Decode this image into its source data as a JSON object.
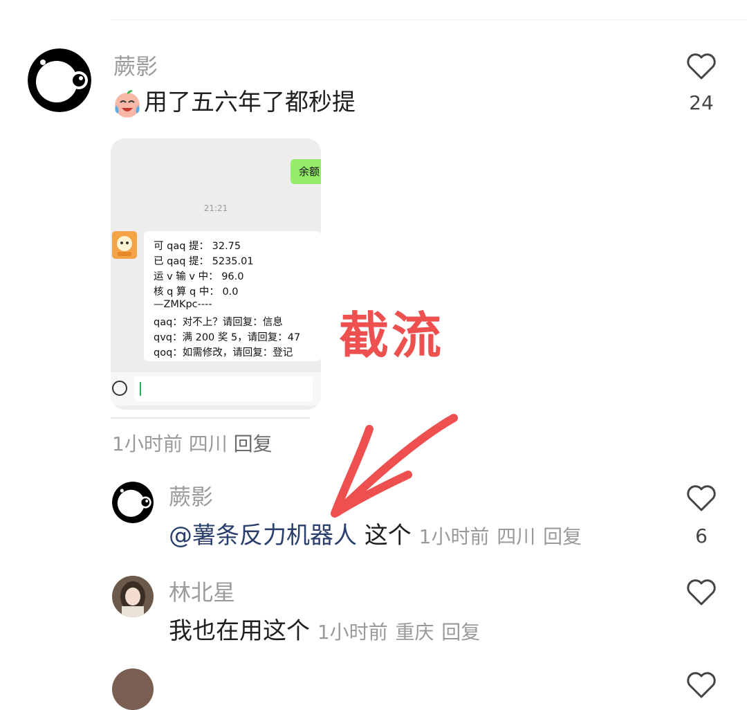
{
  "comments": [
    {
      "user": "蕨影",
      "text": "用了五六年了都秒提",
      "likes": "24",
      "time": "1小时前",
      "location": "四川",
      "reply_label": "回复",
      "attachment": {
        "balance_label": "余额",
        "time": "21:21",
        "bot_lines": [
          "可 qaq 提： 32.75",
          "已 qaq 提： 5235.01",
          "运 v 输 v 中： 96.0",
          "核 q 算 q 中： 0.0",
          "—ZMKpc----",
          "qaq：对不上？请回复：信息",
          "qvq：满 200 奖 5，请回复：47",
          "qoq：如需修改，请回复：登记"
        ]
      }
    },
    {
      "user": "蕨影",
      "mention": "@薯条反力机器人",
      "text": "这个",
      "likes": "6",
      "time": "1小时前",
      "location": "四川",
      "reply_label": "回复"
    },
    {
      "user": "林北星",
      "text": "我也在用这个",
      "time": "1小时前",
      "location": "重庆",
      "reply_label": "回复"
    }
  ],
  "annotation": {
    "text": "截流",
    "color": "#ee5050"
  },
  "icons": {
    "like": "heart-outline-icon",
    "emoji": "crying-laughing-emoji-icon",
    "voice": "voice-input-icon"
  }
}
